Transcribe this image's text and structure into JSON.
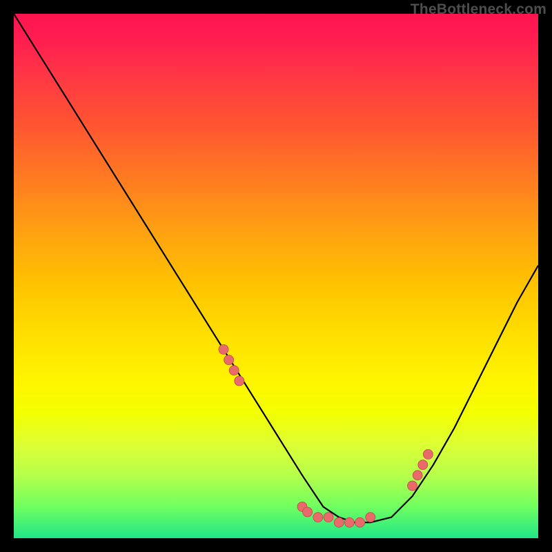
{
  "watermark": "TheBottleneck.com",
  "chart_data": {
    "type": "line",
    "title": "",
    "xlabel": "",
    "ylabel": "",
    "xlim": [
      0,
      100
    ],
    "ylim": [
      0,
      100
    ],
    "grid": false,
    "legend": false,
    "series": [
      {
        "name": "bottleneck-curve",
        "x": [
          0,
          5,
          10,
          15,
          20,
          25,
          30,
          35,
          40,
          45,
          50,
          55,
          57,
          59,
          62,
          65,
          68,
          72,
          76,
          80,
          84,
          88,
          92,
          96,
          100
        ],
        "values": [
          100,
          92,
          84,
          76,
          68,
          60,
          52,
          44,
          36,
          28,
          20,
          12,
          9,
          6,
          4,
          3,
          3,
          4,
          8,
          14,
          21,
          29,
          37,
          45,
          52
        ]
      }
    ],
    "markers": {
      "name": "red-dots",
      "x": [
        40,
        41,
        42,
        43,
        55,
        56,
        58,
        60,
        62,
        64,
        66,
        68,
        76,
        77,
        78,
        79
      ],
      "values": [
        36,
        34,
        32,
        30,
        6,
        5,
        4,
        4,
        3,
        3,
        3,
        4,
        10,
        12,
        14,
        16
      ]
    },
    "gradient_colors": {
      "top": "#ff1450",
      "mid_upper": "#ff7d20",
      "mid": "#ffe100",
      "mid_lower": "#deff34",
      "bottom": "#20e688"
    }
  }
}
